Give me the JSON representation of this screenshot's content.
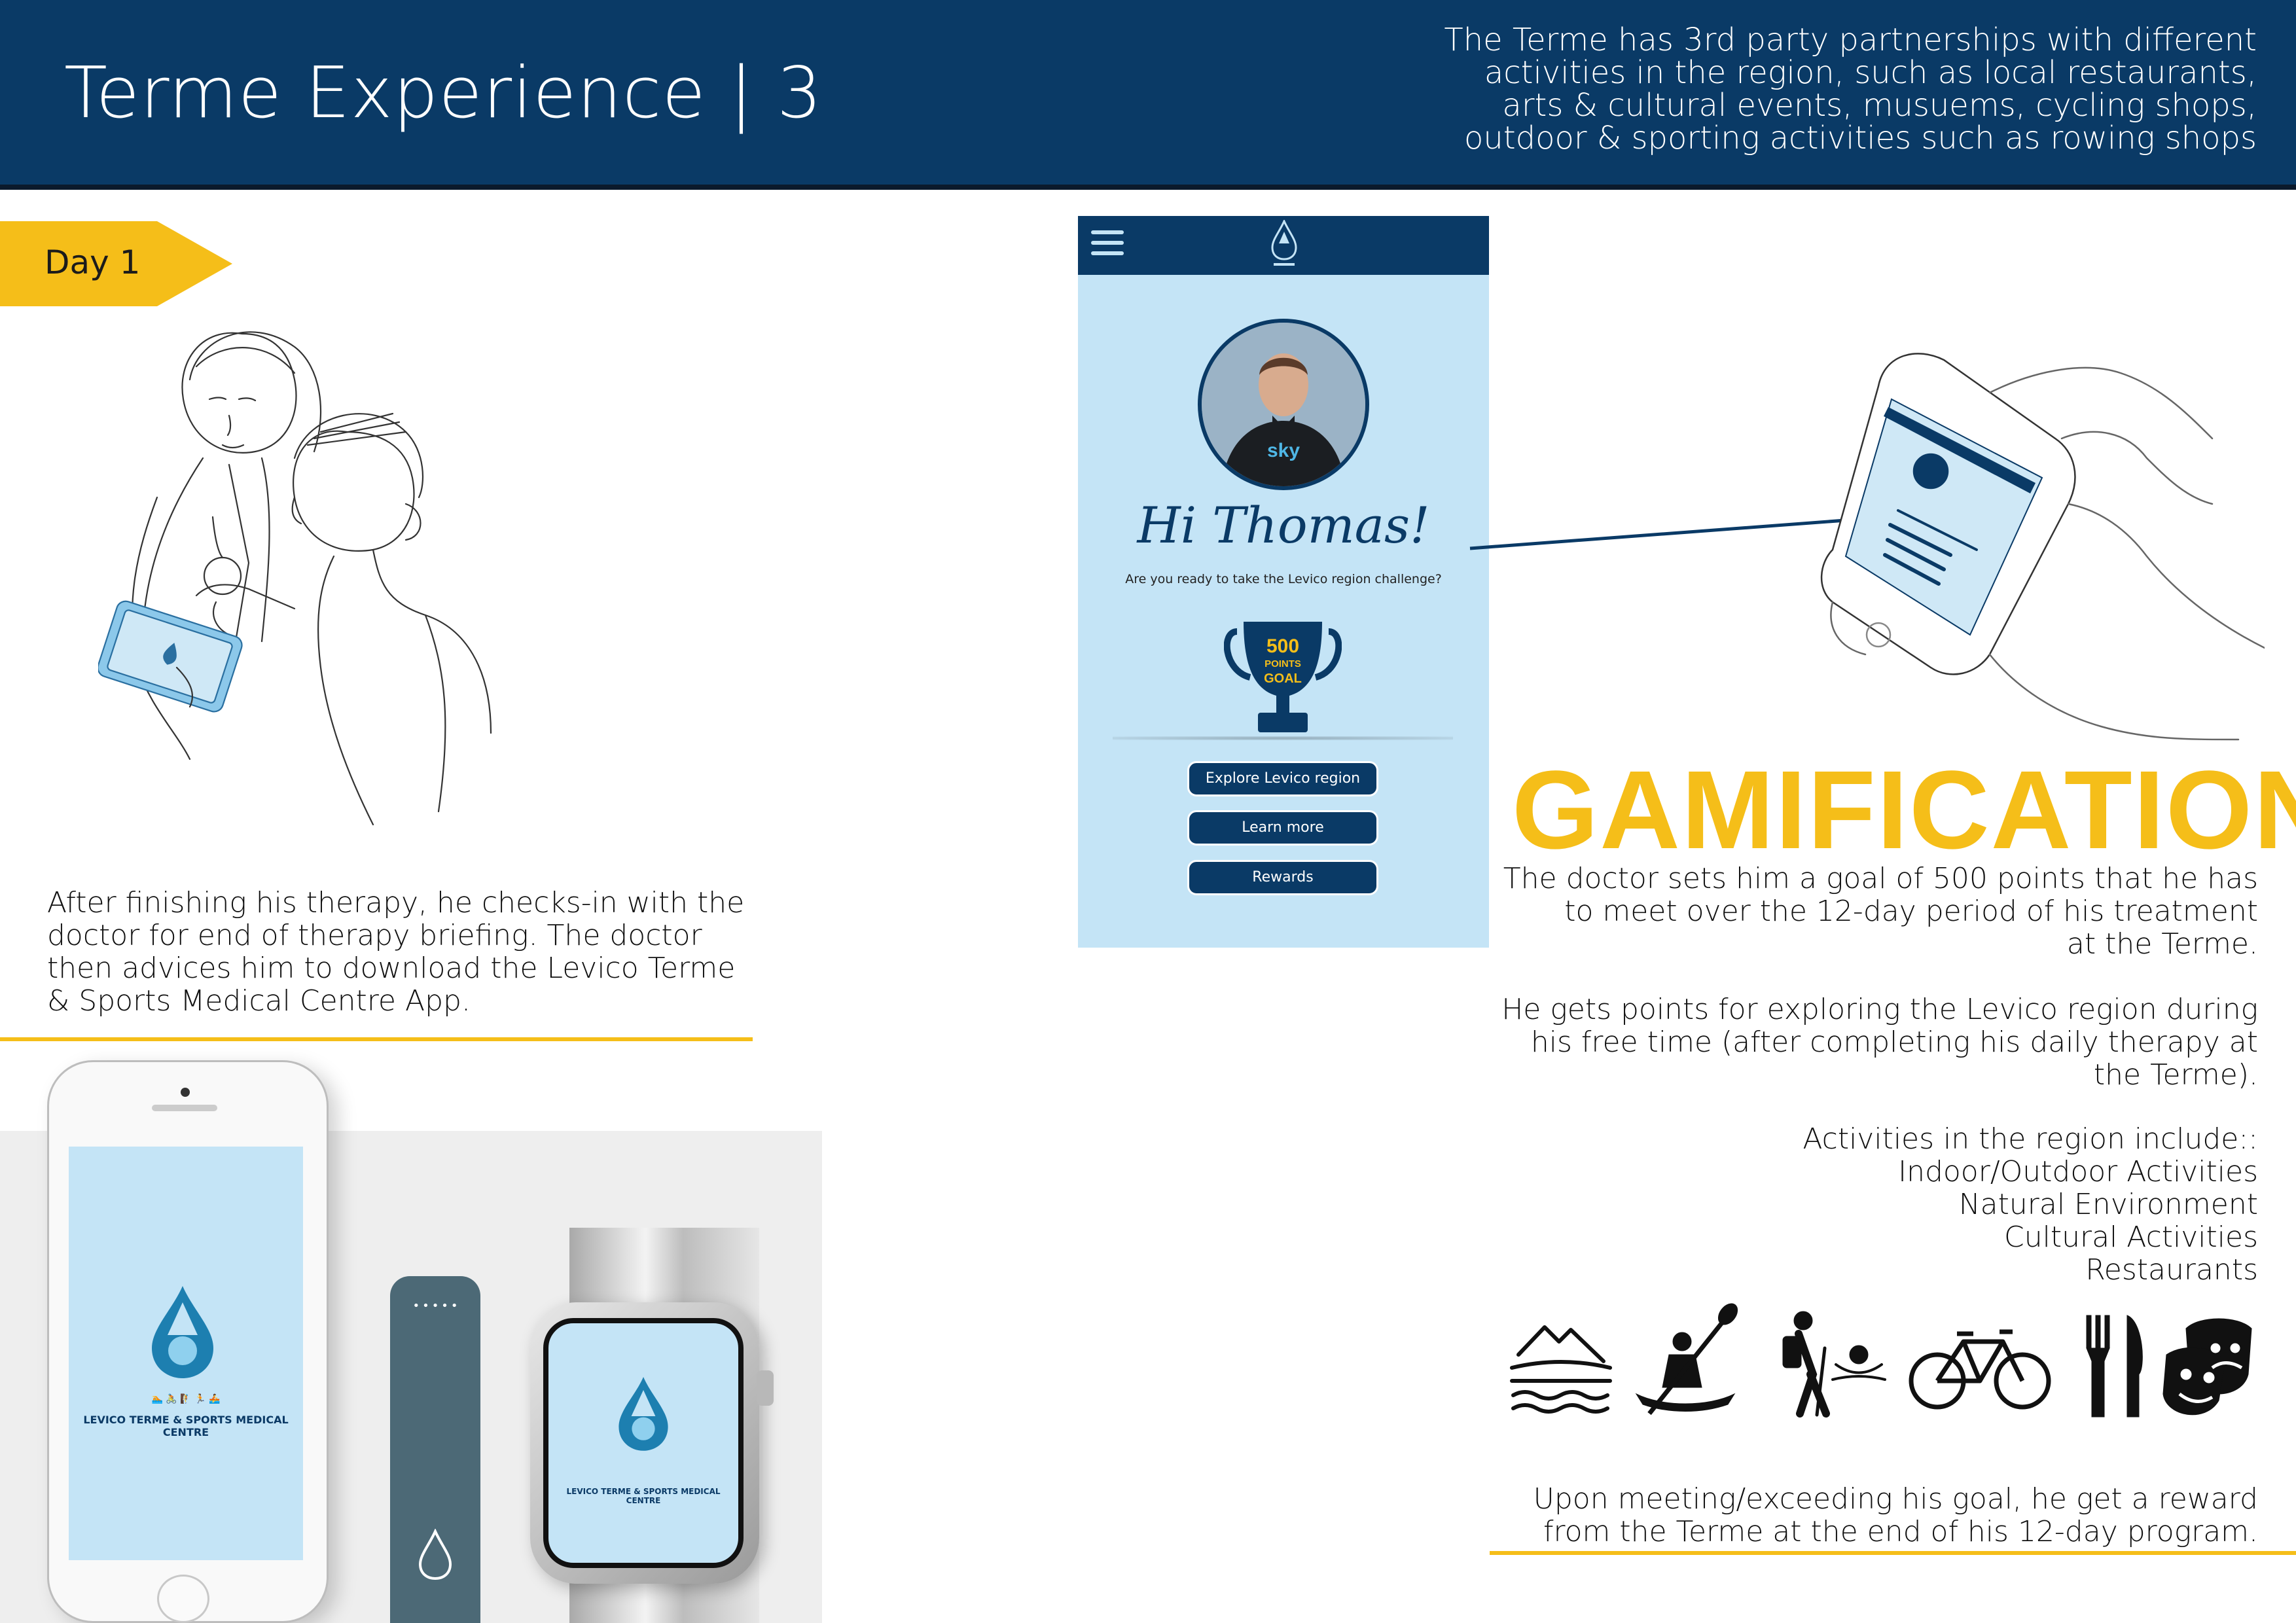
{
  "header": {
    "title": "Terme Experience | 3",
    "note_lines": [
      "The Terme has 3rd party partnerships with different",
      "activities in the region, such as local restaurants,",
      "arts & cultural events, musuems, cycling shops,",
      "outdoor & sporting activities such as rowing shops"
    ]
  },
  "day_badge": {
    "label": "Day 1"
  },
  "left_text": {
    "lines": [
      "After finishing his therapy, he checks-in with the",
      "doctor for end of therapy briefing. The doctor",
      "then advices him to download the Levico Terme",
      "& Sports Medical Centre App."
    ]
  },
  "devices": {
    "app_name": "LEVICO TERME & SPORTS MEDICAL CENTRE",
    "band_dots": "•••••"
  },
  "app": {
    "greeting": "Hi Thomas!",
    "question": "Are you ready to take the Levico region challenge?",
    "trophy": {
      "points": "500",
      "line2": "POINTS",
      "line3": "GOAL"
    },
    "buttons": [
      "Explore Levico region",
      "Learn more",
      "Rewards"
    ]
  },
  "gamification": {
    "title": "GAMIFICATION",
    "paragraph1_lines": [
      "The doctor sets him a goal of 500 points that he has",
      "to meet over the 12-day period of his treatment",
      "at the Terme."
    ],
    "paragraph2_lines": [
      "He gets points for exploring the Levico region during",
      "his free time (after completing his daily therapy at",
      "the Terme)."
    ],
    "activities_lines": [
      "Activities in the region include::",
      "Indoor/Outdoor Activities",
      "Natural Environment",
      "Cultural Activities",
      "Restaurants"
    ],
    "icons": [
      "mountains-water-icon",
      "kayak-icon",
      "hiker-icon",
      "bicycle-icon",
      "fork-knife-icon",
      "theater-masks-icon"
    ],
    "reward_lines": [
      "Upon meeting/exceeding his goal, he get a reward",
      "from the Terme at the end of his 12-day program."
    ]
  },
  "colors": {
    "navy": "#0a3a66",
    "accent_yellow": "#f5be19",
    "app_light_blue": "#c4e4f6"
  }
}
